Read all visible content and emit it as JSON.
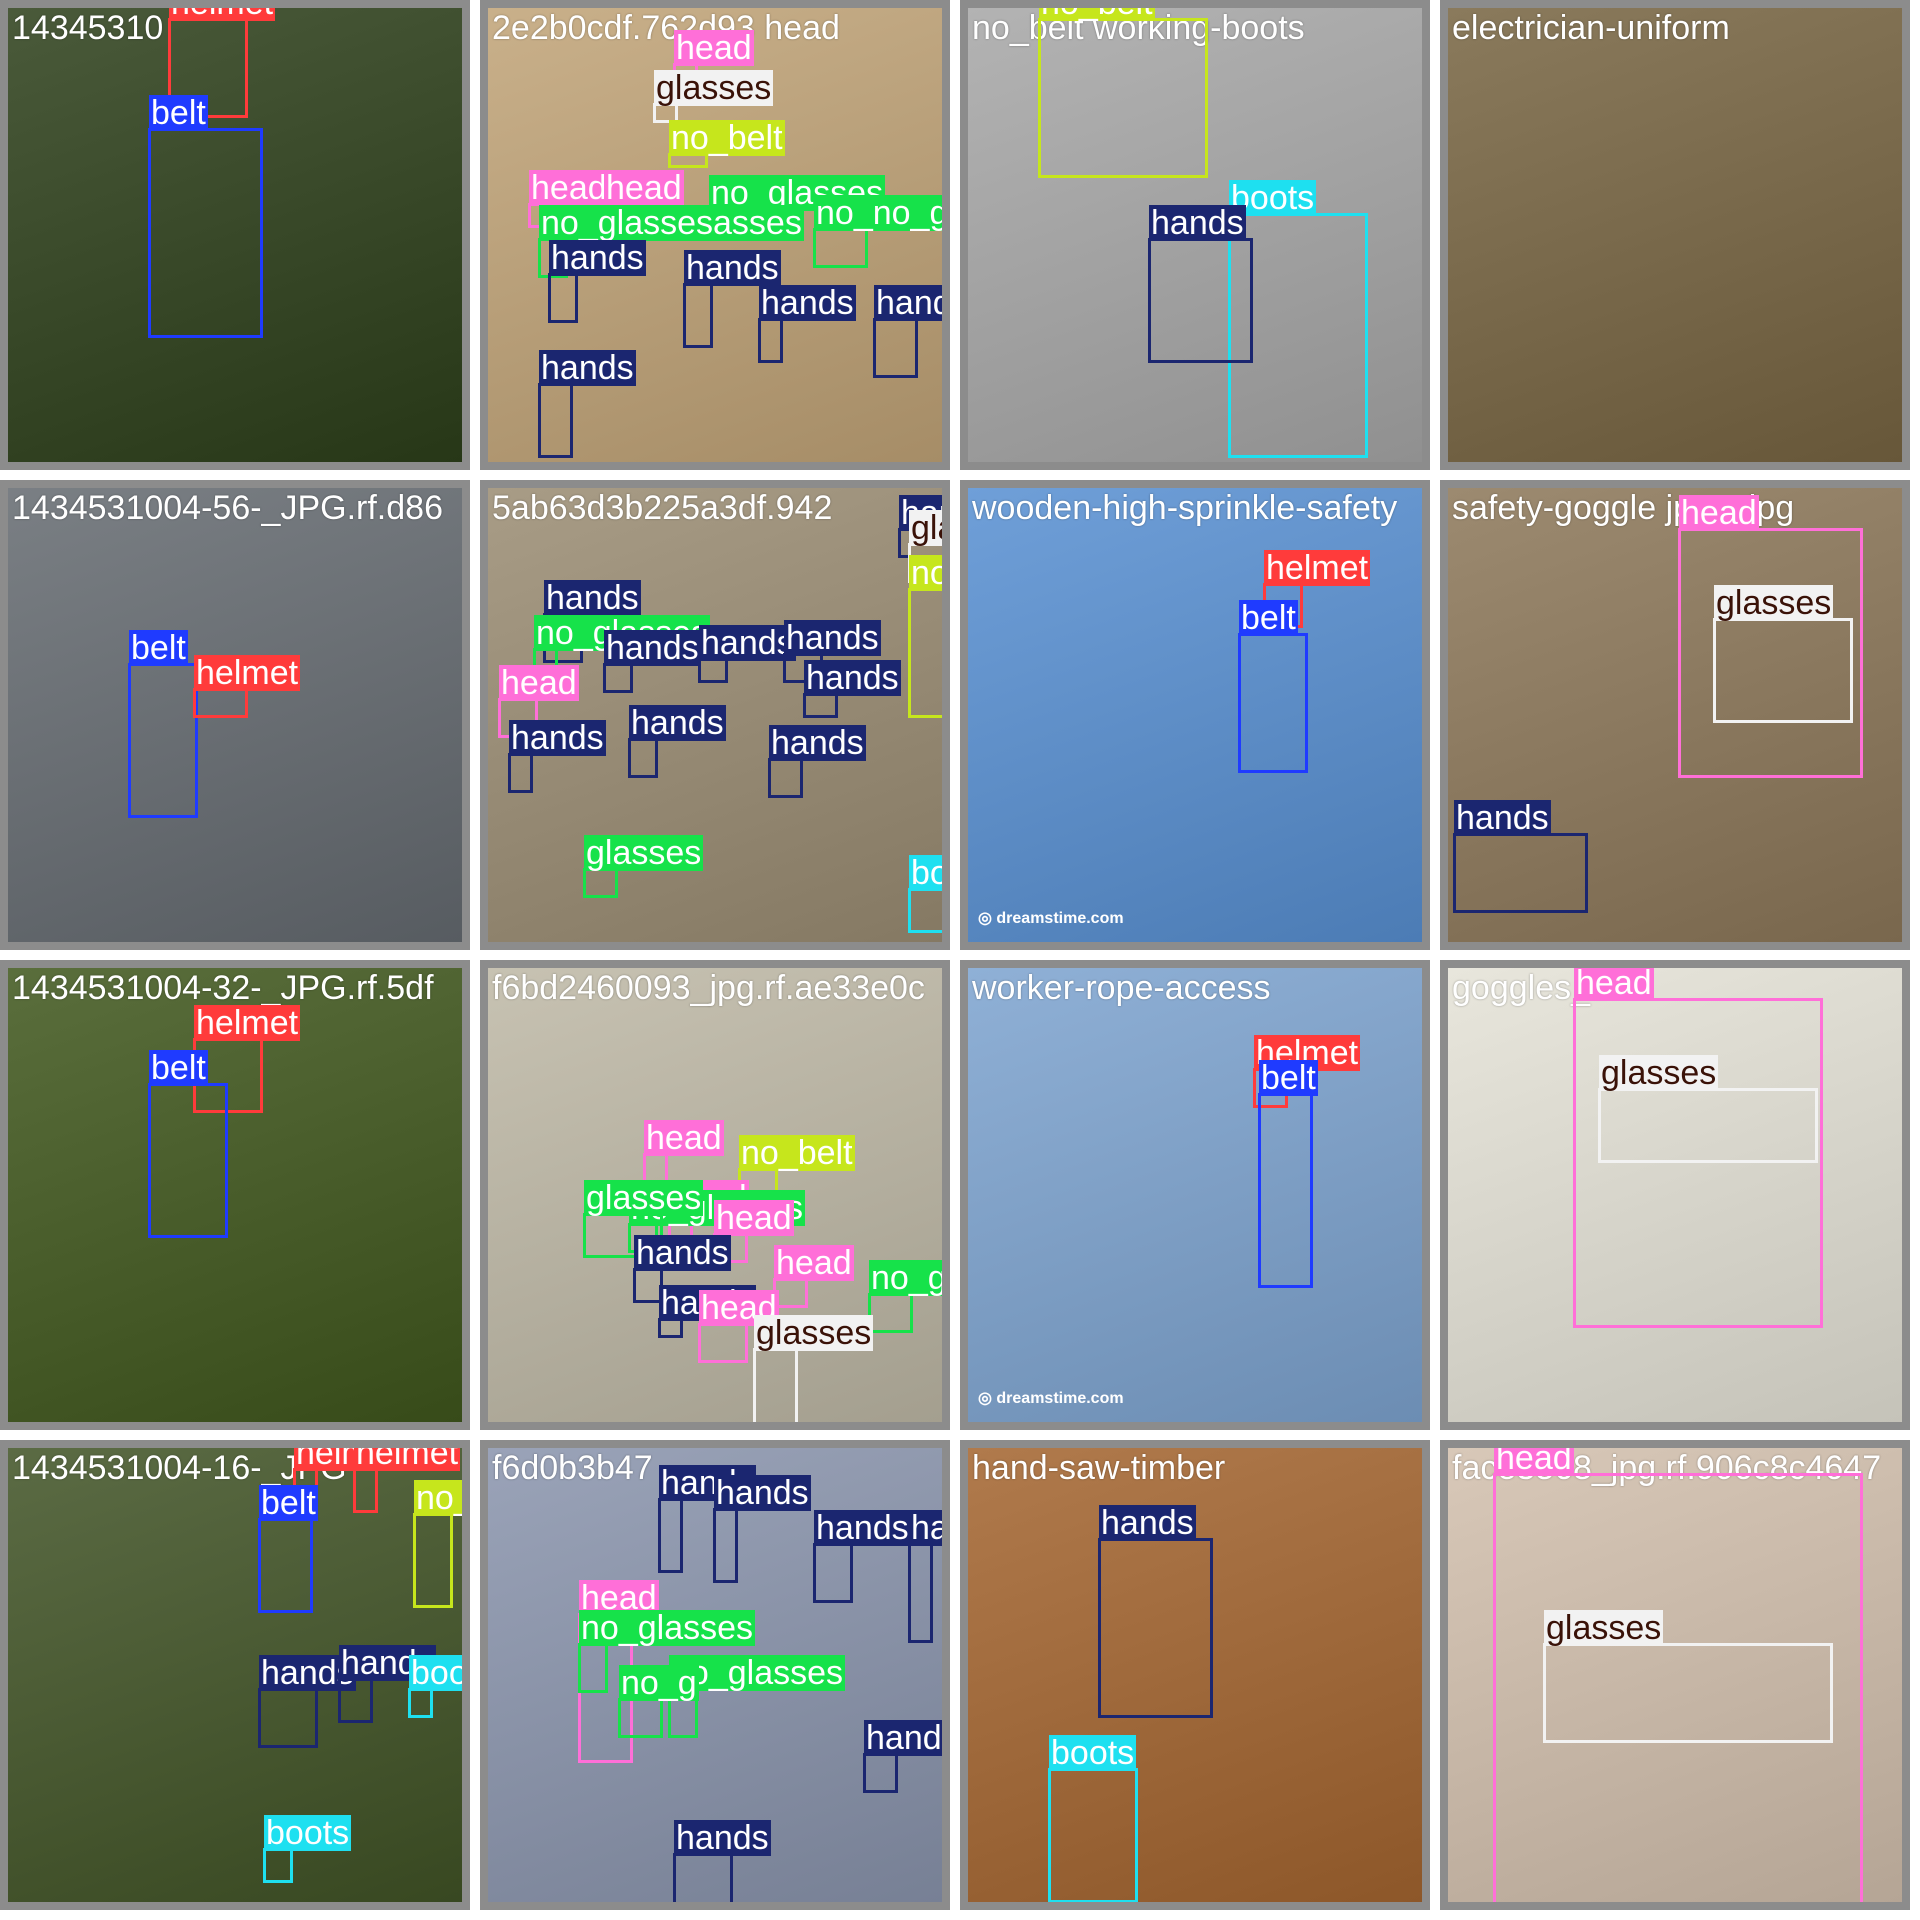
{
  "tiles": [
    {
      "name": "14345310",
      "bg": "#4a5a3a",
      "boxes": [
        {
          "label": "helmet",
          "color": "#ff3b3b"
        },
        {
          "label": "belt",
          "color": "#1f3bff"
        }
      ]
    },
    {
      "name": "2e2b0cdf.762d93 head",
      "bg": "#c9b08a",
      "boxes": [
        {
          "label": "head",
          "color": "#ff6fd8"
        },
        {
          "label": "glasses",
          "color": "#f2f2f2",
          "dark": true
        },
        {
          "label": "no_belt",
          "color": "#c6e61c"
        },
        {
          "label": "head",
          "color": "#ff6fd8"
        },
        {
          "label": "head",
          "color": "#ff6fd8"
        },
        {
          "label": "no_glasses",
          "color": "#16e24a"
        },
        {
          "label": "no_glassesasses",
          "color": "#16e24a"
        },
        {
          "label": "no_no_glasses",
          "color": "#16e24a"
        },
        {
          "label": "hands",
          "color": "#1b2670"
        },
        {
          "label": "hands",
          "color": "#1b2670"
        },
        {
          "label": "hands",
          "color": "#1b2670"
        },
        {
          "label": "hands",
          "color": "#1b2670"
        },
        {
          "label": "hands",
          "color": "#1b2670"
        }
      ]
    },
    {
      "name": "no_belt working-boots",
      "bg": "#b3b3b3",
      "boxes": [
        {
          "label": "no_belt",
          "color": "#c6e61c"
        },
        {
          "label": "boots",
          "color": "#1ee0f0"
        },
        {
          "label": "hands",
          "color": "#1b2670"
        }
      ]
    },
    {
      "name": "electrician-uniform",
      "bg": "#8a7a5c",
      "boxes": []
    },
    {
      "name": "1434531004-56-_JPG.rf.d86",
      "bg": "#7a7f84",
      "boxes": [
        {
          "label": "belt",
          "color": "#1f3bff"
        },
        {
          "label": "helmet",
          "color": "#ff3b3b"
        }
      ]
    },
    {
      "name": "5ab63d3b225a3df.942",
      "bg": "#a89c86",
      "boxes": [
        {
          "label": "hands",
          "color": "#1b2670"
        },
        {
          "label": "glasses",
          "color": "#f2f2f2",
          "dark": true
        },
        {
          "label": "no_belt",
          "color": "#c6e61c"
        },
        {
          "label": "hands",
          "color": "#1b2670"
        },
        {
          "label": "no_glasses",
          "color": "#16e24a"
        },
        {
          "label": "hands",
          "color": "#1b2670"
        },
        {
          "label": "hands",
          "color": "#1b2670"
        },
        {
          "label": "hands",
          "color": "#1b2670"
        },
        {
          "label": "head",
          "color": "#ff6fd8"
        },
        {
          "label": "hands",
          "color": "#1b2670"
        },
        {
          "label": "hands",
          "color": "#1b2670"
        },
        {
          "label": "hands",
          "color": "#1b2670"
        },
        {
          "label": "hands",
          "color": "#1b2670"
        },
        {
          "label": "glasses",
          "color": "#16e24a"
        },
        {
          "label": "boots",
          "color": "#1ee0f0"
        }
      ]
    },
    {
      "name": "wooden-high-sprinkle-safety",
      "bg": "#6f9fd8",
      "wm": "dreamstime.com",
      "boxes": [
        {
          "label": "helmet",
          "color": "#ff3b3b"
        },
        {
          "label": "belt",
          "color": "#1f3bff"
        }
      ]
    },
    {
      "name": "safety-goggle jpeg_jpg",
      "bg": "#9c8a70",
      "boxes": [
        {
          "label": "head",
          "color": "#ff6fd8"
        },
        {
          "label": "glasses",
          "color": "#f2f2f2",
          "dark": true
        },
        {
          "label": "hands",
          "color": "#1b2670"
        }
      ]
    },
    {
      "name": "1434531004-32-_JPG.rf.5df",
      "bg": "#5a6e3c",
      "boxes": [
        {
          "label": "helmet",
          "color": "#ff3b3b"
        },
        {
          "label": "belt",
          "color": "#1f3bff"
        }
      ]
    },
    {
      "name": "f6bd2460093_jpg.rf.ae33e0c",
      "bg": "#c7c2b2",
      "boxes": [
        {
          "label": "head",
          "color": "#ff6fd8"
        },
        {
          "label": "no_belt",
          "color": "#c6e61c"
        },
        {
          "label": "head",
          "color": "#ff6fd8"
        },
        {
          "label": "no_glasses",
          "color": "#16e24a"
        },
        {
          "label": "head",
          "color": "#ff6fd8"
        },
        {
          "label": "glasses",
          "color": "#16e24a"
        },
        {
          "label": "hands",
          "color": "#1b2670"
        },
        {
          "label": "hands",
          "color": "#1b2670"
        },
        {
          "label": "head",
          "color": "#ff6fd8"
        },
        {
          "label": "no_glasses",
          "color": "#16e24a"
        },
        {
          "label": "head",
          "color": "#ff6fd8"
        },
        {
          "label": "glasses",
          "color": "#f2f2f2",
          "dark": true
        }
      ]
    },
    {
      "name": "worker-rope-access",
      "bg": "#8fb0d6",
      "wm": "dreamstime.com",
      "boxes": [
        {
          "label": "helmet",
          "color": "#ff3b3b"
        },
        {
          "label": "belt",
          "color": "#1f3bff"
        }
      ]
    },
    {
      "name": "goggles_14",
      "bg": "#e8e6dc",
      "boxes": [
        {
          "label": "head",
          "color": "#ff6fd8"
        },
        {
          "label": "glasses",
          "color": "#f2f2f2",
          "dark": true
        }
      ]
    },
    {
      "name": "1434531004-16-_JPG",
      "bg": "#5b6b44",
      "boxes": [
        {
          "label": "helmet",
          "color": "#ff3b3b"
        },
        {
          "label": "helmet",
          "color": "#ff3b3b"
        },
        {
          "label": "belt",
          "color": "#1f3bff"
        },
        {
          "label": "no_belt",
          "color": "#c6e61c"
        },
        {
          "label": "hands",
          "color": "#1b2670"
        },
        {
          "label": "hands",
          "color": "#1b2670"
        },
        {
          "label": "boots",
          "color": "#1ee0f0"
        },
        {
          "label": "boots",
          "color": "#1ee0f0"
        }
      ]
    },
    {
      "name": "f6d0b3b47",
      "bg": "#9aa3b8",
      "boxes": [
        {
          "label": "hands",
          "color": "#1b2670"
        },
        {
          "label": "hands",
          "color": "#1b2670"
        },
        {
          "label": "hands",
          "color": "#1b2670"
        },
        {
          "label": "hands",
          "color": "#1b2670"
        },
        {
          "label": "head",
          "color": "#ff6fd8"
        },
        {
          "label": "no_glasses",
          "color": "#16e24a"
        },
        {
          "label": "no_glasses",
          "color": "#16e24a"
        },
        {
          "label": "no_g",
          "color": "#16e24a"
        },
        {
          "label": "hands",
          "color": "#1b2670"
        },
        {
          "label": "hands",
          "color": "#1b2670"
        }
      ]
    },
    {
      "name": "hand-saw-timber",
      "bg": "#b07a4c",
      "boxes": [
        {
          "label": "hands",
          "color": "#1b2670"
        },
        {
          "label": "boots",
          "color": "#1ee0f0"
        }
      ]
    },
    {
      "name": "face3868_jpg.rf.906c8c4647",
      "bg": "#d8c8b8",
      "boxes": [
        {
          "label": "head",
          "color": "#ff6fd8"
        },
        {
          "label": "glasses",
          "color": "#f2f2f2",
          "dark": true
        }
      ]
    }
  ]
}
